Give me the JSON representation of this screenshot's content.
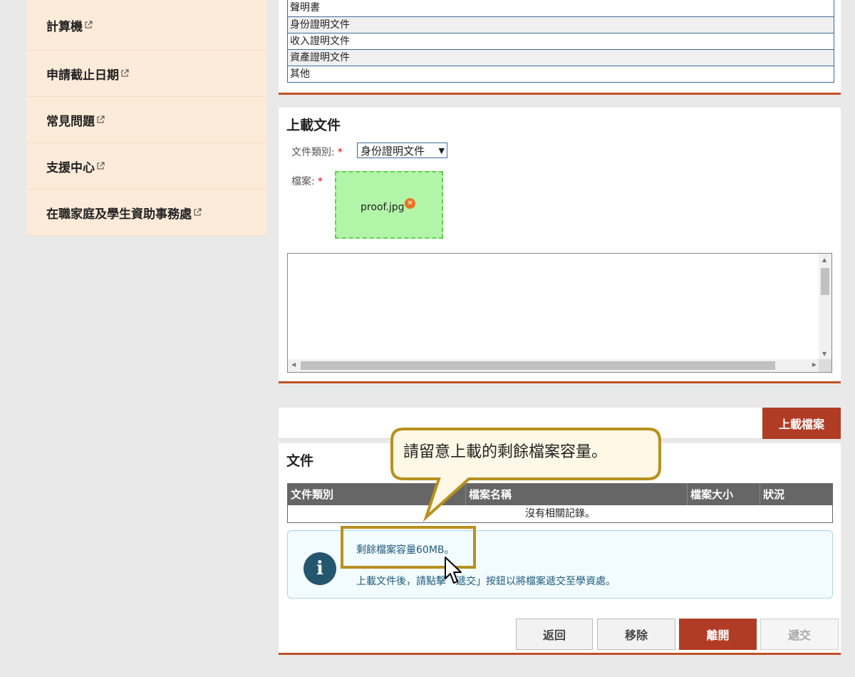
{
  "sidebar": {
    "items": [
      {
        "label": "計算機"
      },
      {
        "label": "申請截止日期"
      },
      {
        "label": "常見問題"
      },
      {
        "label": "支援中心"
      },
      {
        "label": "在職家庭及學生資助事務處"
      }
    ]
  },
  "doc_types": {
    "items": [
      "聲明書",
      "身份證明文件",
      "收入證明文件",
      "資產證明文件",
      "其他"
    ]
  },
  "upload": {
    "title": "上載文件",
    "doc_type_label": "文件類別:",
    "required_mark": "*",
    "doc_type_selected": "身份證明文件",
    "file_label": "檔案:",
    "file_name": "proof.jpg",
    "upload_button": "上載檔案"
  },
  "documents": {
    "title": "文件",
    "columns": [
      "文件類別",
      "檔案名稱",
      "檔案大小",
      "狀況"
    ],
    "empty_text": "沒有相關記錄。"
  },
  "info": {
    "line1": "剩餘檔案容量60MB。",
    "line2": "上載文件後，請點擊「遞交」按鈕以將檔案遞交至學資處。"
  },
  "buttons": {
    "back": "返回",
    "remove": "移除",
    "leave": "離開",
    "submit": "遞交"
  },
  "callout": {
    "text": "請留意上載的剩餘檔案容量。"
  },
  "colors": {
    "accent": "#b03c25",
    "highlight": "#b8911d",
    "dropzone": "#b2f5a8"
  }
}
